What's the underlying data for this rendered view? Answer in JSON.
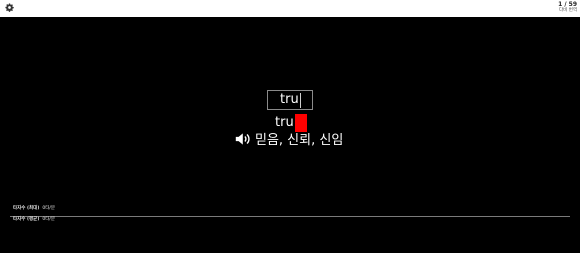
{
  "header": {
    "settings_icon": "gear-icon",
    "counter": "1 / 59",
    "mode_label": "다비 번역"
  },
  "card": {
    "input_value": "tru",
    "typed_text": "tru",
    "error_color": "#ff0000",
    "speaker_icon": "speaker-icon",
    "meaning": "믿음, 신뢰, 신임"
  },
  "info": [
    {
      "key": "타자수 (최대)",
      "value": "0타/분"
    },
    {
      "key": "타자수 (평균)",
      "value": "0타/분"
    }
  ]
}
